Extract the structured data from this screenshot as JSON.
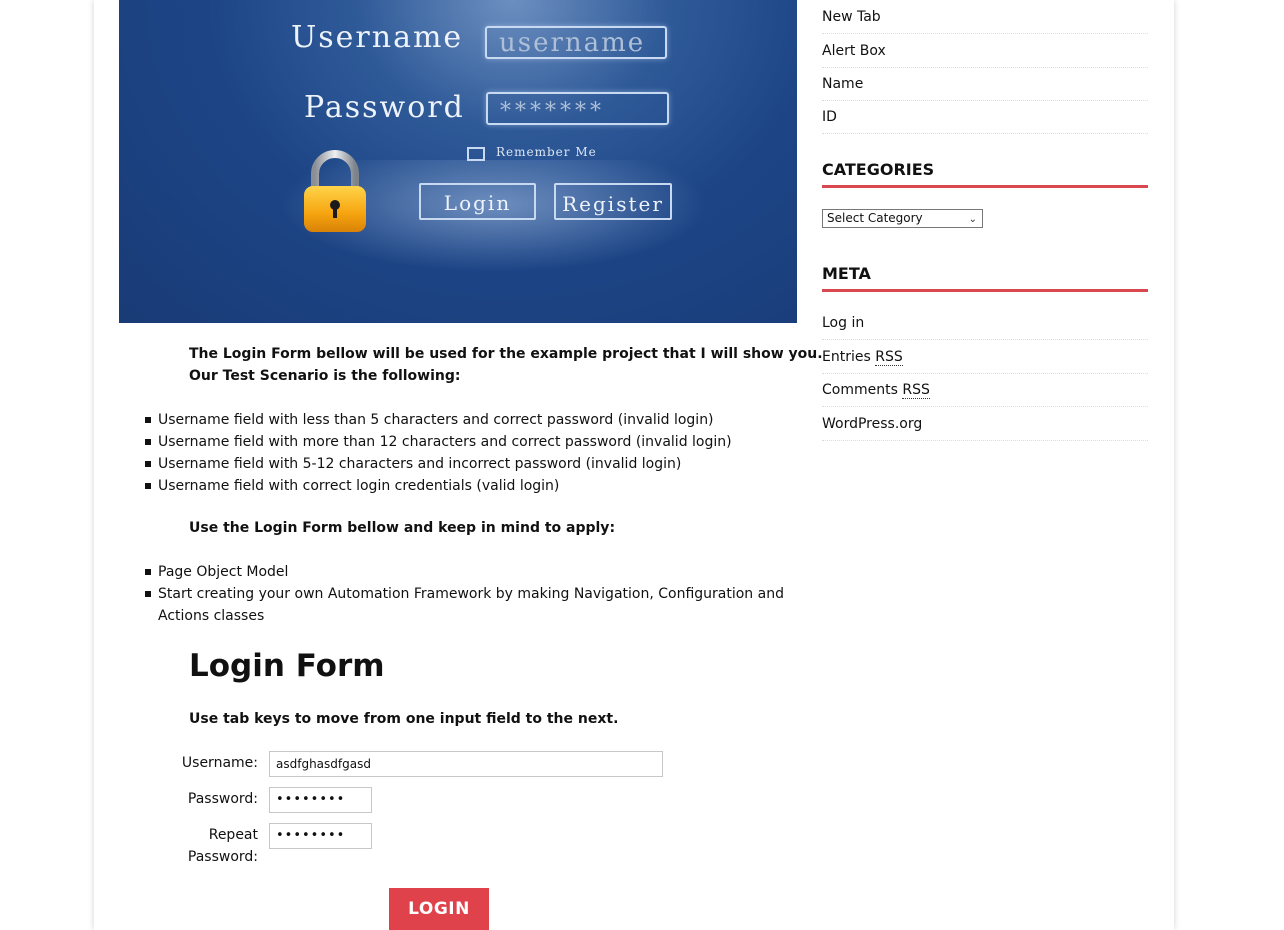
{
  "hero": {
    "username_label": "Username",
    "username_placeholder": "username",
    "password_label": "Password",
    "password_mask": "*******",
    "remember_me": "Remember Me",
    "login_button": "Login",
    "register_button": "Register",
    "lock_icon": "padlock-icon"
  },
  "intro": {
    "line1": "The Login Form bellow will be used for the example project that I will show you.",
    "line2": "Our Test Scenario is the following:"
  },
  "scenarios": [
    "Username field with less than 5 characters and correct password (invalid login)",
    "Username field with more than 12 characters and correct password (invalid login)",
    "Username field with 5-12 characters and incorrect password (invalid login)",
    "Username field with correct login credentials (valid login)"
  ],
  "apply_heading": "Use the Login Form bellow and keep in mind to apply:",
  "apply_items": [
    "Page Object Model",
    "Start creating your own Automation Framework by making Navigation, Configuration and Actions classes"
  ],
  "form": {
    "title": "Login Form",
    "hint": "Use tab keys to move from one input field to the next.",
    "username_label": "Username:",
    "username_value": "asdfghasdfgasd",
    "password_label": "Password:",
    "password_value": "••••••••",
    "repeat_label_1": "Repeat",
    "repeat_label_2": "Password:",
    "repeat_value": "••••••••",
    "submit_label": "LOGIN"
  },
  "sidebar": {
    "top_links": [
      "New Tab",
      "Alert Box",
      "Name",
      "ID"
    ],
    "categories_heading": "CATEGORIES",
    "category_select": "Select Category",
    "meta_heading": "META",
    "meta_links": {
      "login": "Log in",
      "entries": "Entries",
      "comments": "Comments",
      "rss": "RSS",
      "wordpress": "WordPress.org"
    }
  },
  "colors": {
    "accent": "#e0424c",
    "hero_blue": "#1d4586"
  }
}
